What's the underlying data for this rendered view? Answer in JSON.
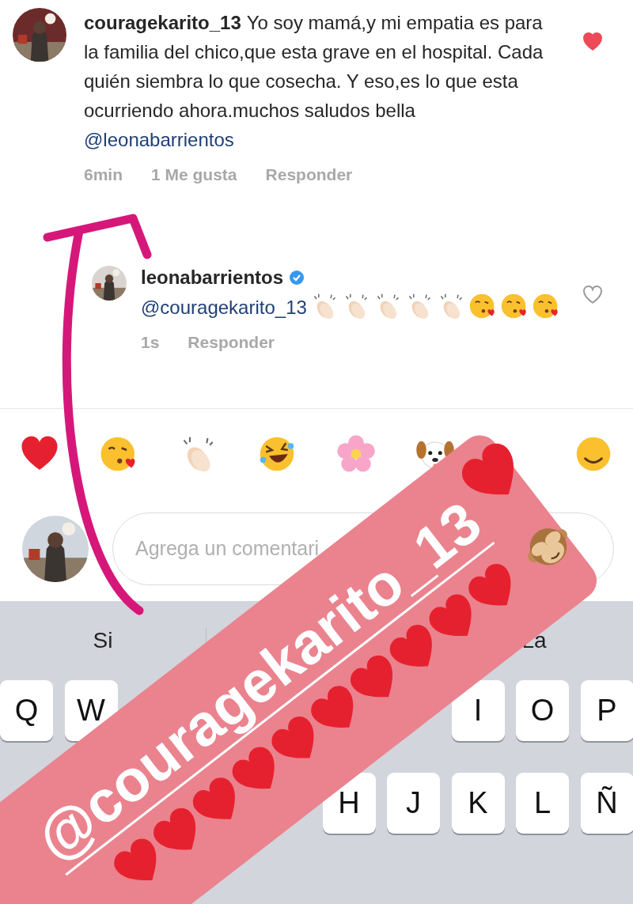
{
  "comments": [
    {
      "username": "couragekarito_13",
      "text": "Yo soy mamá,y mi empatia es para la familia del chico,que esta grave en el hospital. Cada quién siembra lo que cosecha. Y eso,es lo que esta ocurriendo ahora.muchos saludos bella",
      "mention": "@leonabarrientos",
      "liked": true,
      "time": "6min",
      "likes": "1 Me gusta",
      "reply": "Responder",
      "kind": "comment"
    },
    {
      "username": "leonabarrientos",
      "mention": "@couragekarito_13",
      "liked": false,
      "time": "1s",
      "reply": "Responder",
      "verified": true,
      "kind": "reply"
    }
  ],
  "composer": {
    "placeholder": "Agrega un comentari"
  },
  "suggestions": [
    "Si",
    "La"
  ],
  "keyboard": [
    [
      {
        "label": "Q"
      },
      {
        "label": "W"
      },
      {
        "label": "I"
      },
      {
        "label": "O"
      },
      {
        "label": "P"
      }
    ],
    [
      {
        "label": "H"
      },
      {
        "label": "J"
      },
      {
        "label": "K"
      },
      {
        "label": "L"
      },
      {
        "label": "Ñ"
      }
    ]
  ],
  "sticker": {
    "mention": "@couragekarito_13"
  }
}
